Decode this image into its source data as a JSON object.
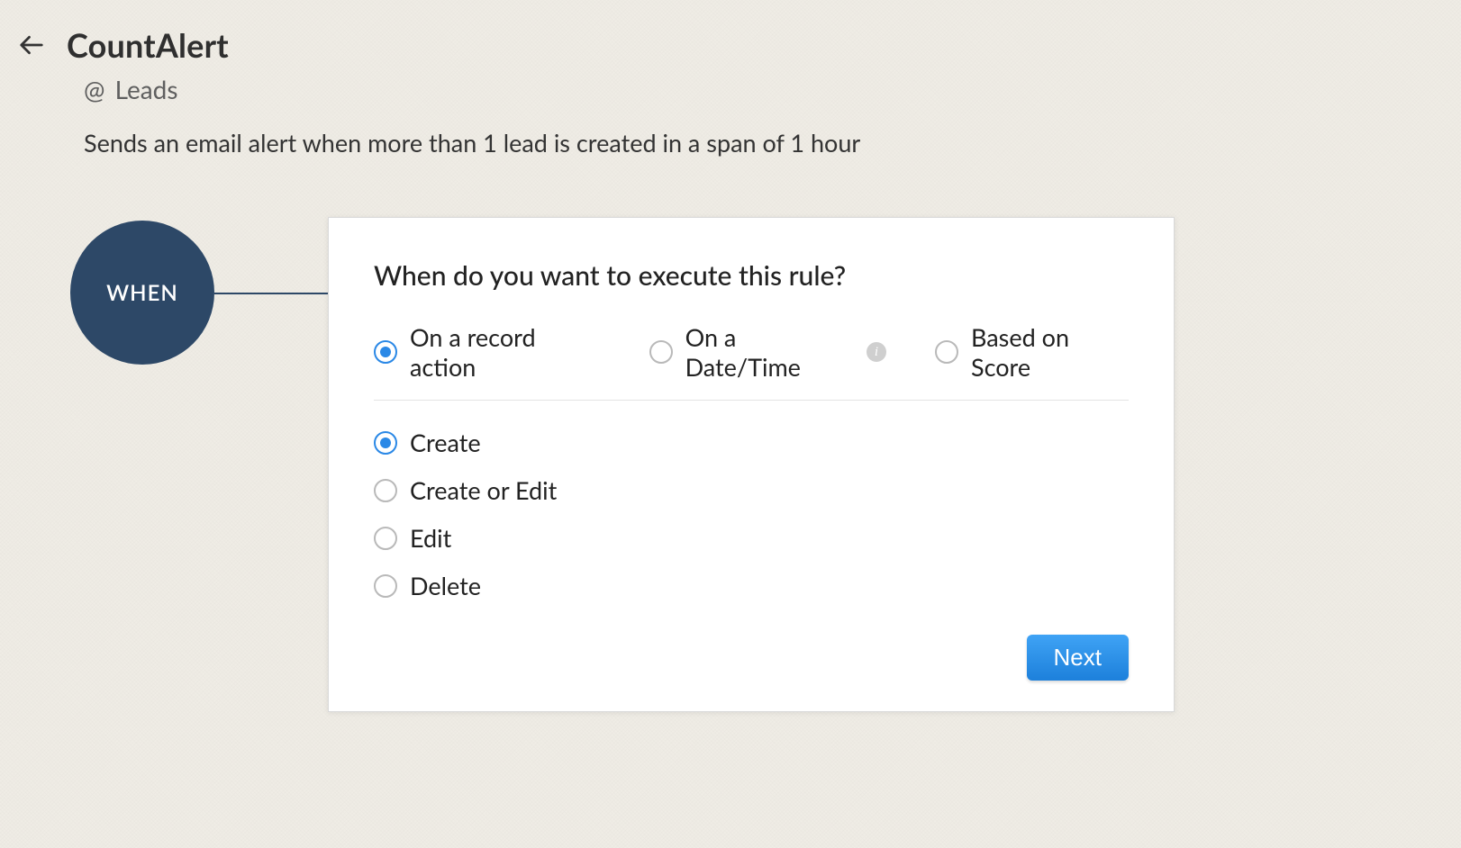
{
  "header": {
    "title": "CountAlert",
    "module_prefix": "@",
    "module": "Leads",
    "description": "Sends an email alert when more than 1 lead is created in a span of 1 hour"
  },
  "stage": {
    "step_label": "WHEN"
  },
  "card": {
    "question": "When do you want to execute this rule?",
    "triggers": [
      {
        "label": "On a record action",
        "selected": true
      },
      {
        "label": "On a Date/Time",
        "selected": false,
        "info": true
      },
      {
        "label": "Based on Score",
        "selected": false
      }
    ],
    "actions": [
      {
        "label": "Create",
        "selected": true
      },
      {
        "label": "Create or Edit",
        "selected": false
      },
      {
        "label": "Edit",
        "selected": false
      },
      {
        "label": "Delete",
        "selected": false
      }
    ],
    "next_label": "Next"
  },
  "icons": {
    "info_glyph": "i"
  }
}
